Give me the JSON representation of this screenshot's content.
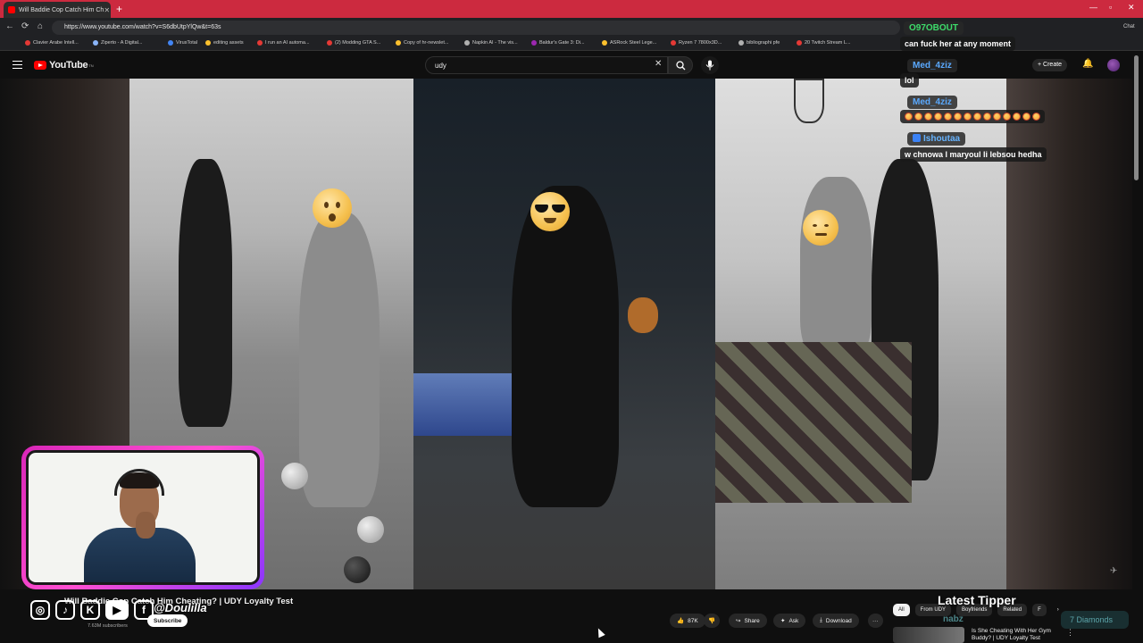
{
  "browser": {
    "tab_title": "Will Baddie Cop Catch Him Ch",
    "tab_close": "✕",
    "new_tab": "+",
    "url": "https://www.youtube.com/watch?v=S6dbUtpYlQw&t=63s",
    "win_min": "—",
    "win_max": "▫",
    "win_close": "✕",
    "back": "←",
    "forward": "→",
    "reload": "⟳",
    "home": "⌂",
    "chat_label": "Chat",
    "bookmarks": [
      {
        "label": "Clavier Arabe Intell...",
        "color": "#e53935"
      },
      {
        "label": "Ziperto - A Digital...",
        "color": "#8ab4f8"
      },
      {
        "label": "VirusTotal",
        "color": "#4285f4"
      },
      {
        "label": "editing assets",
        "color": "#fbc02d"
      },
      {
        "label": "I run an AI automa...",
        "color": "#e53935"
      },
      {
        "label": "(2) Modding GTA S...",
        "color": "#e53935"
      },
      {
        "label": "Copy of hr-newslet...",
        "color": "#fbc02d"
      },
      {
        "label": "Napkin AI - The vis...",
        "color": "#b0b0b0"
      },
      {
        "label": "Baldur's Gate 3: Di...",
        "color": "#9c27b0"
      },
      {
        "label": "ASRock Steel Lege...",
        "color": "#fbc02d"
      },
      {
        "label": "Ryzen 7 7800x3D...",
        "color": "#e53935"
      },
      {
        "label": "bibliographi pfe",
        "color": "#b0b0b0"
      },
      {
        "label": "20 Twitch Stream L...",
        "color": "#e53935"
      }
    ]
  },
  "youtube": {
    "logo_text": "YouTube",
    "logo_sup": "TN",
    "search_value": "udy",
    "search_clear": "✕",
    "create_label": "Create",
    "bell": "🔔"
  },
  "video": {
    "title": "Will Baddie Cop Catch Him Cheating? | UDY Loyalty Test",
    "subscribers": "7.63M subscribers",
    "subscribe_label": "Subscribe",
    "likes": "87K",
    "share_label": "Share",
    "ask_label": "Ask",
    "download_label": "Download",
    "more": "···",
    "watermark": "✈"
  },
  "overlay": {
    "handle": "@Doulilla",
    "socials": [
      "◎",
      "♪",
      "K",
      "▶",
      "f"
    ],
    "latest_tipper_label": "Latest Tipper",
    "tipper_name": "nabz",
    "tipper_amount": "7 Diamonds"
  },
  "chips": [
    "All",
    "From UDY",
    "Boyfriends",
    "Related",
    "F"
  ],
  "chip_next": "›",
  "recommendation": {
    "title": "Is She Cheating With Her Gym Buddy? | UDY Loyalty Test",
    "more": "⋮"
  },
  "chat": [
    {
      "user": "O97OBOUT",
      "user_color": "#3ddc6b",
      "message": "can fuck her at any moment",
      "emotes": 0
    },
    {
      "user": "Med_4ziz",
      "user_color": "#5aa9ff",
      "message": "lol",
      "emotes": 0
    },
    {
      "user": "Med_4ziz",
      "user_color": "#5aa9ff",
      "message": "",
      "emotes": 14
    },
    {
      "user": "Ishoutaa",
      "user_color": "#66b3ff",
      "message": "w chnowa l maryoul li lebsou hedha",
      "emotes": 0
    }
  ]
}
